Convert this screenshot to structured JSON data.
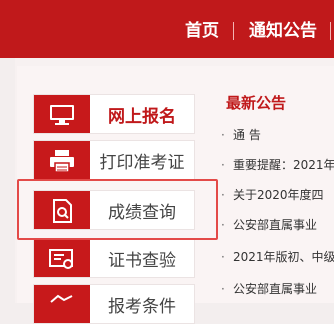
{
  "nav": {
    "items": [
      {
        "label": "首页"
      },
      {
        "label": "通知公告"
      }
    ]
  },
  "menu": {
    "items": [
      {
        "label": "网上报名",
        "icon": "monitor-icon",
        "active": true
      },
      {
        "label": "打印准考证",
        "icon": "printer-icon",
        "active": false
      },
      {
        "label": "成绩查询",
        "icon": "document-search-icon",
        "active": false
      },
      {
        "label": "证书查验",
        "icon": "certificate-icon",
        "active": false
      },
      {
        "label": "报考条件",
        "icon": "handshake-icon",
        "active": false
      }
    ],
    "highlighted": "成绩查询"
  },
  "news": {
    "title": "最新公告",
    "items": [
      {
        "text": "通 告"
      },
      {
        "text": "重要提醒：2021年"
      },
      {
        "text": "关于2020年度四"
      },
      {
        "text": "公安部直属事业"
      },
      {
        "text": "2021年版初、中级"
      },
      {
        "text": "公安部直属事业"
      }
    ]
  },
  "colors": {
    "brand_red": "#c0191b",
    "highlight_border": "#e34a48"
  }
}
